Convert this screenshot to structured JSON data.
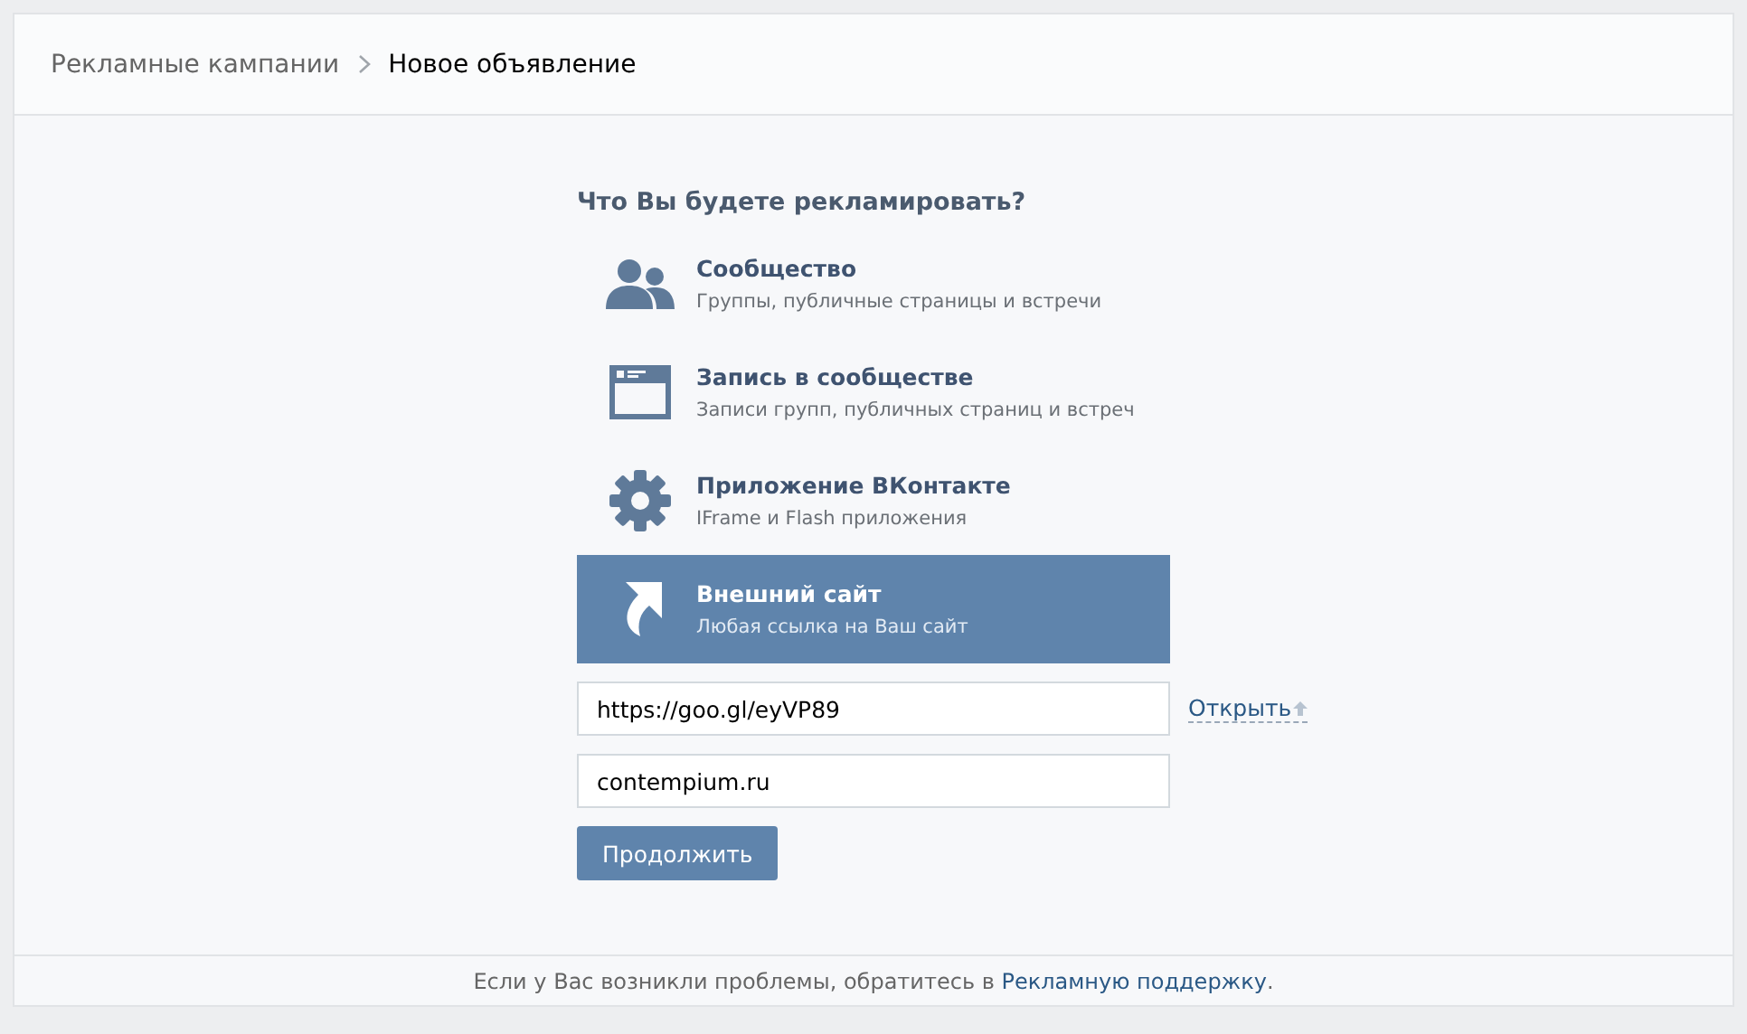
{
  "breadcrumb": [
    {
      "label": "Рекламные кампании",
      "current": false
    },
    {
      "label": "Новое объявление",
      "current": true
    }
  ],
  "heading": "Что Вы будете рекламировать?",
  "options": [
    {
      "kind": "community",
      "title": "Сообщество",
      "subtitle": "Группы, публичные страницы и встречи",
      "selected": false
    },
    {
      "kind": "post",
      "title": "Запись в сообществе",
      "subtitle": "Записи групп, публичных страниц и встреч",
      "selected": false
    },
    {
      "kind": "app",
      "title": "Приложение ВКонтакте",
      "subtitle": "IFrame и Flash приложения",
      "selected": false
    },
    {
      "kind": "site",
      "title": "Внешний сайт",
      "subtitle": "Любая ссылка на Ваш сайт",
      "selected": true
    }
  ],
  "url_field": {
    "value": "https://goo.gl/eyVP89"
  },
  "open_link": "Открыть",
  "domain_field": {
    "value": "contempium.ru"
  },
  "continue_button": "Продолжить",
  "footer": {
    "text": "Если у Вас возникли проблемы, обратитесь в ",
    "link": "Рекламную поддержку",
    "end": "."
  }
}
